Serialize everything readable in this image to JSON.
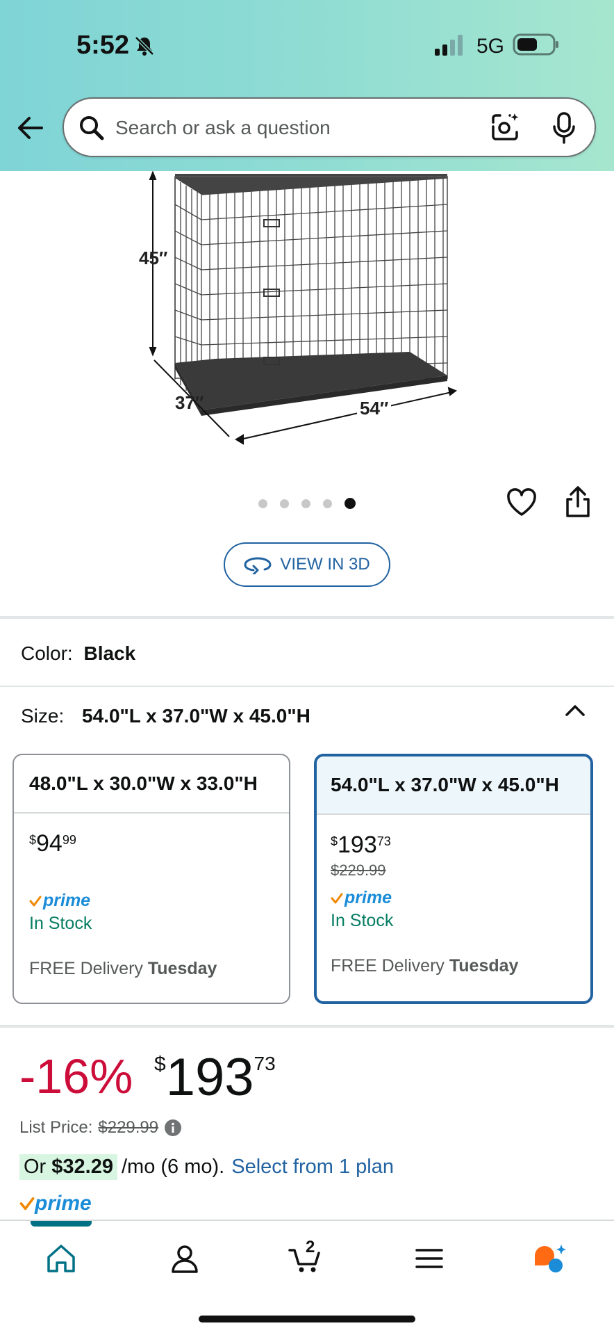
{
  "status_bar": {
    "time": "5:52",
    "network": "5G"
  },
  "search": {
    "placeholder": "Search or ask a question"
  },
  "product_image": {
    "dimension_height": "45″",
    "dimension_depth": "37″",
    "dimension_width": "54″",
    "carousel_count": 5,
    "carousel_active_index": 4
  },
  "view_3d_label": "VIEW IN 3D",
  "color": {
    "label": "Color:",
    "value": "Black"
  },
  "size": {
    "label": "Size:",
    "value": "54.0\"L x 37.0\"W x 45.0\"H",
    "options": [
      {
        "title": "48.0\"L x 30.0\"W x 33.0\"H",
        "price_currency": "$",
        "price_whole": "94",
        "price_fraction": "99",
        "list_price": "",
        "prime": "prime",
        "stock": "In Stock",
        "delivery_prefix": "FREE Delivery",
        "delivery_day": "Tuesday",
        "selected": false
      },
      {
        "title": "54.0\"L x 37.0\"W x 45.0\"H",
        "price_currency": "$",
        "price_whole": "193",
        "price_fraction": "73",
        "list_price": "$229.99",
        "prime": "prime",
        "stock": "In Stock",
        "delivery_prefix": "FREE Delivery",
        "delivery_day": "Tuesday",
        "selected": true
      }
    ]
  },
  "price": {
    "discount": "-16%",
    "currency": "$",
    "whole": "193",
    "fraction": "73",
    "list_price_label": "List Price:",
    "list_price_value": "$229.99",
    "monthly_prefix": "Or",
    "monthly_amount": "$32.29",
    "monthly_suffix": "/mo (6 mo).",
    "plan_link": "Select from 1 plan",
    "prime": "prime"
  },
  "bottom_nav": {
    "cart_count": "2"
  },
  "colors": {
    "accent": "#2162a1",
    "discount": "#cc0c39",
    "in_stock": "#067d62",
    "prime": "#1a8cd8",
    "teal": "#007185"
  }
}
